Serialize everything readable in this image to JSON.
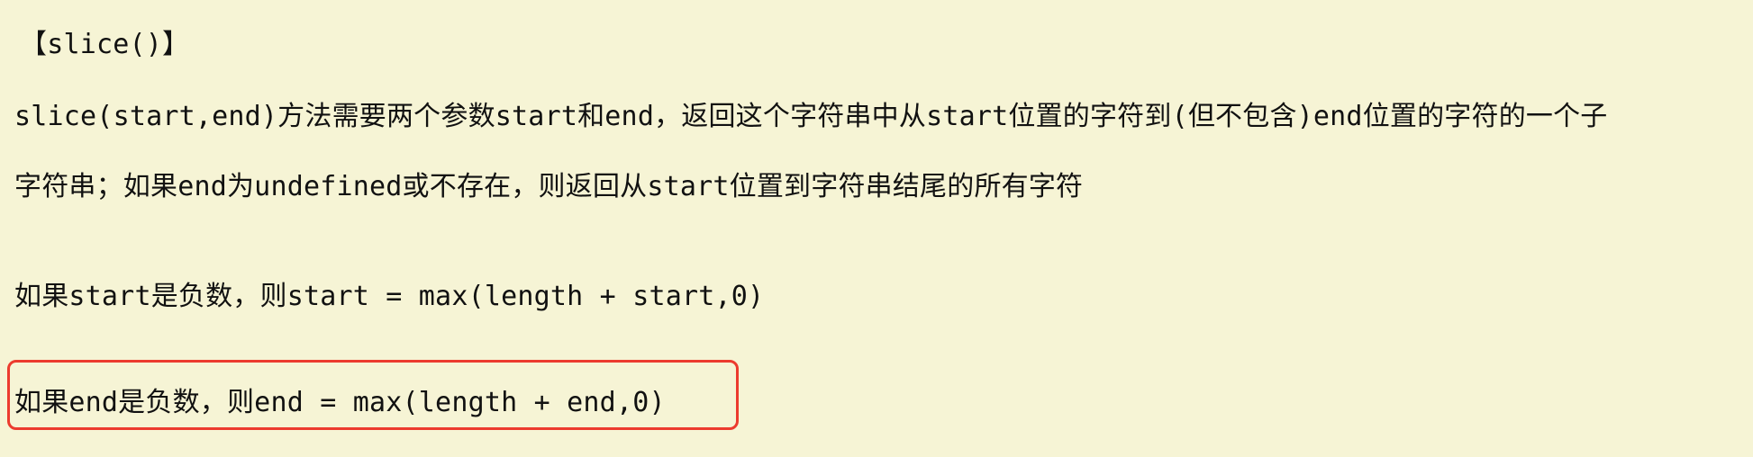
{
  "document": {
    "heading": "【slice()】",
    "paragraph_line1": "slice(start,end)方法需要两个参数start和end，返回这个字符串中从start位置的字符到(但不包含)end位置的字符的一个子",
    "paragraph_line2": "字符串；如果end为undefined或不存在，则返回从start位置到字符串结尾的所有字符",
    "rule_start": "如果start是负数，则start = max(length + start,0)",
    "rule_end": "如果end是负数，则end = max(length + end,0)"
  },
  "colors": {
    "background": "#f6f4d5",
    "highlight_border": "#ec3b2e",
    "text": "#111111"
  }
}
